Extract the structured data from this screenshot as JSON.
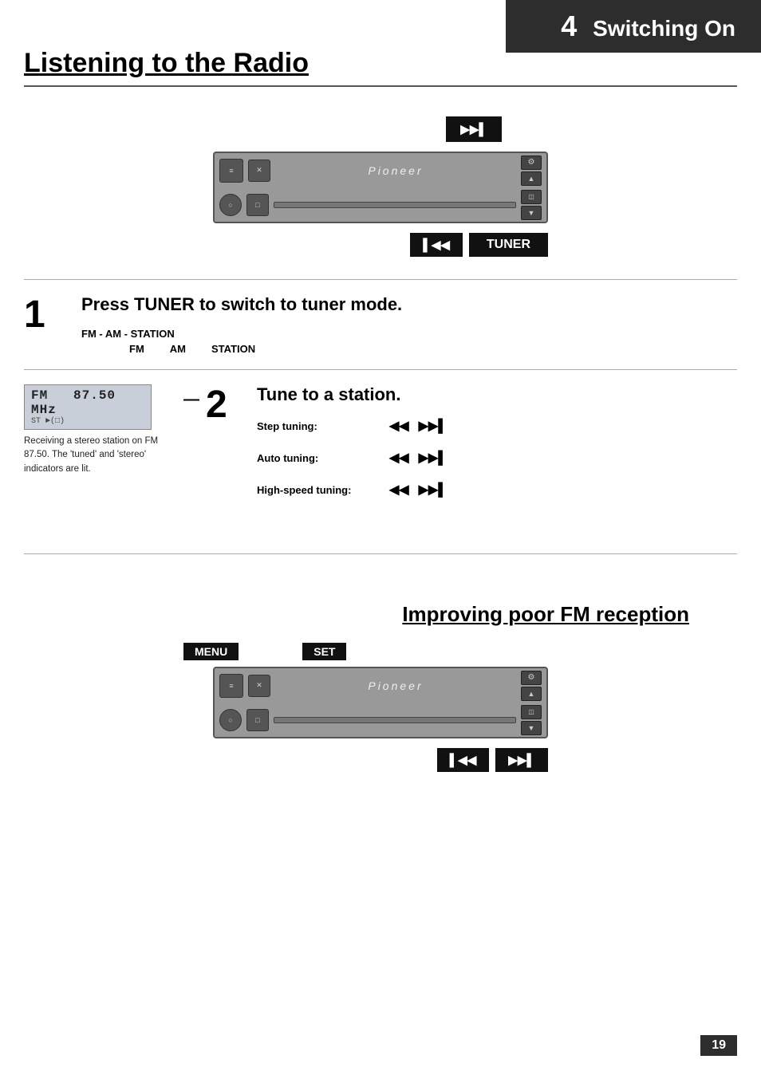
{
  "header": {
    "chapter": "4",
    "title": "Switching On"
  },
  "page_title": "Listening to the Radio",
  "step1": {
    "number": "1",
    "instruction": "Press TUNER to switch to tuner mode.",
    "fm_am_label": "FM - AM - STATION",
    "fm_am_items": [
      "FM",
      "AM",
      "STATION"
    ]
  },
  "step2": {
    "number": "2",
    "instruction": "Tune to a station.",
    "display_freq": "87.50 MHz",
    "display_mode": "FM",
    "display_sub": "ST ►(□)",
    "caption": "Receiving a stereo station on FM 87.50. The 'tuned' and 'stereo' indicators are lit.",
    "tuning_rows": [
      {
        "label": "Step tuning:",
        "icons": "◀◀  ▶▶▶"
      },
      {
        "label": "Auto tuning:",
        "icons": "◀◀  ▶▶▶"
      },
      {
        "label": "High-speed tuning:",
        "icons": "◀◀  ▶▶▶"
      }
    ]
  },
  "section2": {
    "title": "Improving poor FM reception",
    "menu_label": "MENU",
    "set_label": "SET"
  },
  "page_number": "19",
  "buttons": {
    "ff": "▶▶▌",
    "rew": "▌◀◀",
    "tuner": "TUNER",
    "rew2": "▌◀◀",
    "ff2": "▶▶▌"
  }
}
